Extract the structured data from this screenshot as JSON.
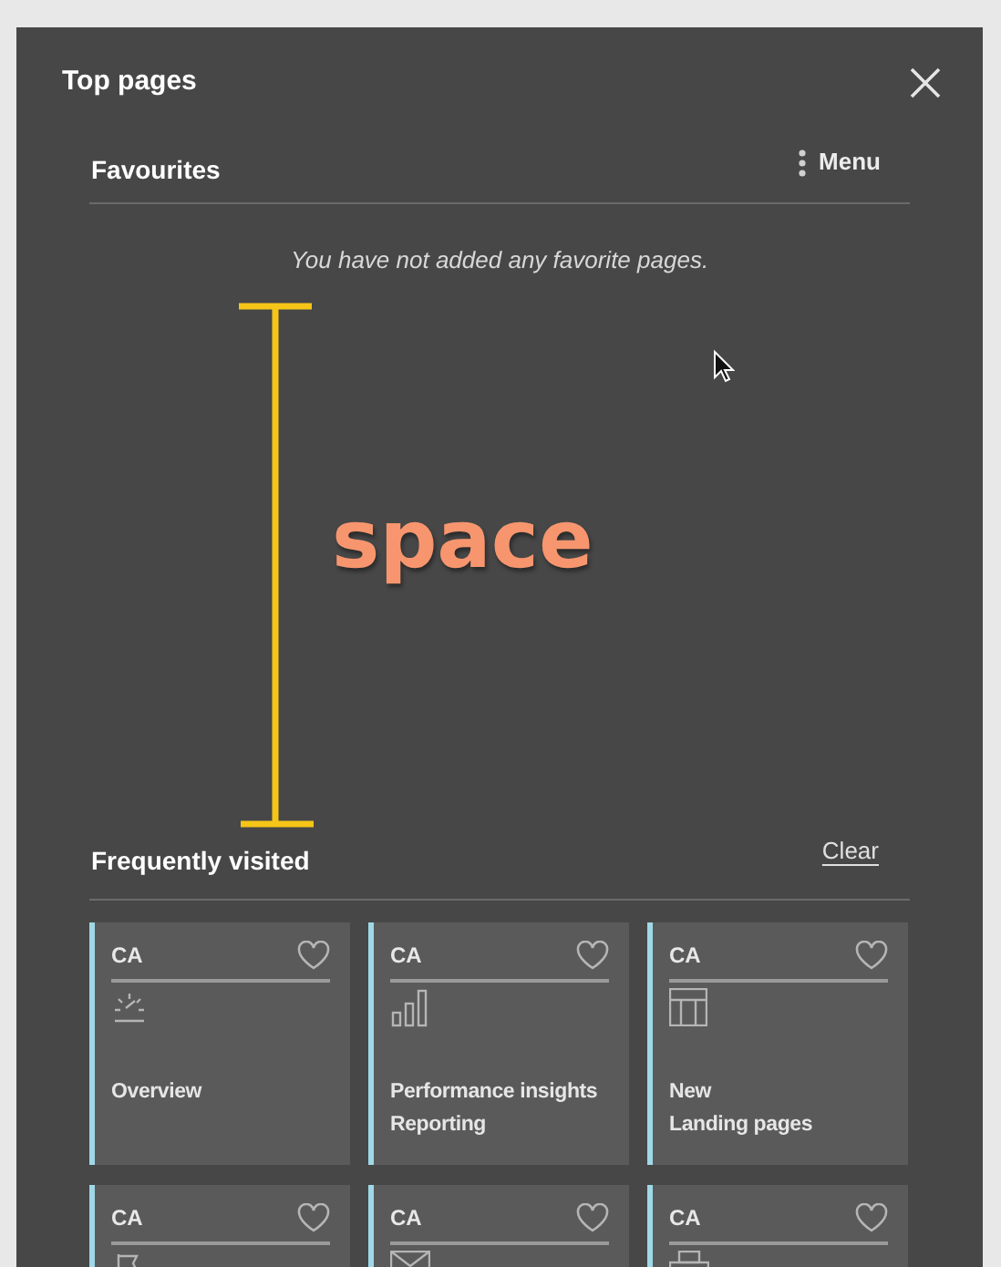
{
  "panel": {
    "title": "Top pages"
  },
  "favourites": {
    "title": "Favourites",
    "menu_label": "Menu",
    "empty_message": "You have not added any favorite pages."
  },
  "frequently_visited": {
    "title": "Frequently visited",
    "clear_label": "Clear",
    "cards": [
      {
        "product": "CA",
        "title_lines": [
          "Overview"
        ],
        "favorited": false
      },
      {
        "product": "CA",
        "title_lines": [
          "Performance insights",
          "Reporting"
        ],
        "favorited": false
      },
      {
        "product": "CA",
        "title_lines": [
          "New",
          "Landing pages"
        ],
        "favorited": false
      },
      {
        "product": "CA",
        "favorited": false
      },
      {
        "product": "CA",
        "favorited": false
      },
      {
        "product": "CA",
        "favorited": false
      }
    ]
  },
  "annotation": {
    "label": "space"
  }
}
